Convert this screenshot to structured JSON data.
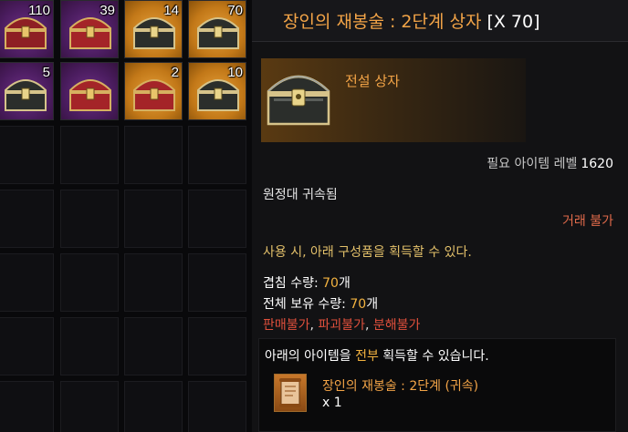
{
  "inventory": {
    "slots": [
      {
        "qty": "110",
        "grade": "epic"
      },
      {
        "qty": "39",
        "grade": "epic"
      },
      {
        "qty": "14",
        "grade": "legend"
      },
      {
        "qty": "70",
        "grade": "legend"
      },
      {
        "qty": "5",
        "grade": "epic"
      },
      {
        "qty": "",
        "grade": "epic"
      },
      {
        "qty": "2",
        "grade": "legend"
      },
      {
        "qty": "10",
        "grade": "legend"
      }
    ]
  },
  "tooltip": {
    "title": "장인의 재봉술 : 2단계 상자",
    "count": "[X 70]",
    "grade": "전설 상자",
    "item_level_label": "필요 아이템 레벨",
    "item_level": "1620",
    "bound": "원정대 귀속됨",
    "trade": "거래 불가",
    "use_text": "사용 시, 아래 구성품을 획득할 수 있다.",
    "stack_label": "겹침 수량: ",
    "stack_value": "70",
    "stack_unit": "개",
    "owned_label": "전체 보유 수량: ",
    "owned_value": "70",
    "owned_unit": "개",
    "restrict_1": "판매불가",
    "restrict_2": "파괴불가",
    "restrict_3": "분해불가",
    "box_head_pre": "아래의 아이템을 ",
    "box_head_hl": "전부",
    "box_head_post": " 획득할 수 있습니다.",
    "reward_name": "장인의 재봉술 : 2단계 (귀속)",
    "reward_qty": "x 1"
  },
  "colors": {
    "legend_orange": "#f3a447",
    "epic_purple": "#6d2f86",
    "warning_red": "#e0503c",
    "value_gold": "#f3b340"
  }
}
